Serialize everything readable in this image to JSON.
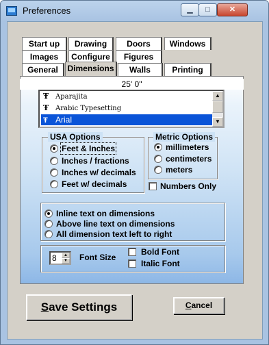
{
  "window": {
    "title": "Preferences"
  },
  "title_buttons": {
    "minimize": "▁",
    "maximize": "□",
    "close": "✕"
  },
  "tabs": {
    "row1": [
      "Start up",
      "Drawing",
      "Doors",
      "Windows"
    ],
    "row2": [
      "Images",
      "Configure",
      "Figures"
    ],
    "row3": [
      "General",
      "Dimensions",
      "Walls",
      "Printing"
    ]
  },
  "dimension_value": "25' 0\"",
  "font_list": {
    "items": [
      "Aparajita",
      "Arabic Typesetting",
      "Arial"
    ],
    "selected": "Arial"
  },
  "usa_options": {
    "legend": "USA Options",
    "options": [
      "Feet & Inches",
      "Inches / fractions",
      "Inches w/ decimals",
      "Feet w/ decimals"
    ],
    "selected": "Feet & Inches"
  },
  "metric_options": {
    "legend": "Metric Options",
    "options": [
      "millimeters",
      "centimeters",
      "meters"
    ],
    "selected": "millimeters",
    "numbers_only_label": "Numbers Only",
    "numbers_only": false
  },
  "text_placement": {
    "options": [
      "Inline text on dimensions",
      "Above line text on dimensions",
      "All dimension text left to right"
    ],
    "selected": "Inline text on dimensions"
  },
  "font_settings": {
    "size_value": "8",
    "size_label": "Font Size",
    "bold_label": "Bold Font",
    "bold": false,
    "italic_label": "Italic Font",
    "italic": false
  },
  "buttons": {
    "save_accel": "S",
    "save_rest": "ave Settings",
    "cancel_accel": "C",
    "cancel_rest": "ancel"
  },
  "colors": {
    "selection": "#0a54d8",
    "title_bar": "#bcd3ec",
    "panel_gradient_end": "#8db7e6"
  }
}
